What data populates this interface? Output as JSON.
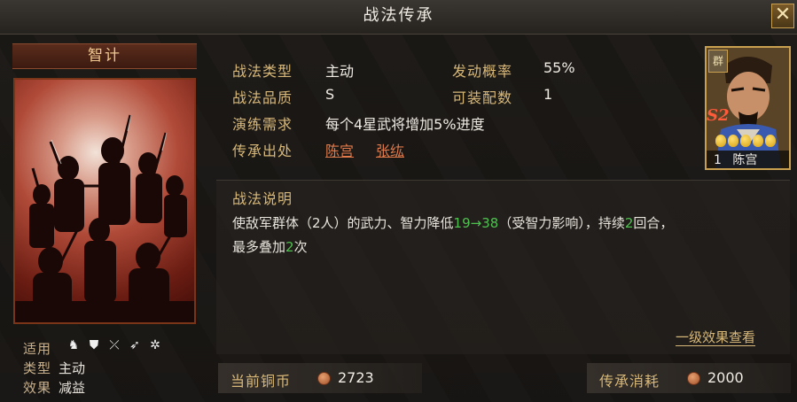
{
  "window": {
    "title": "战法传承",
    "close_label": "✕"
  },
  "skill_card": {
    "name": "智计",
    "terrain_label": "适用",
    "terrain_icons": [
      "cavalry-icon",
      "shield-icon",
      "bow-icon",
      "spear-icon",
      "wheel-icon"
    ],
    "type_label": "类型",
    "type_value": "主动",
    "effect_label": "效果",
    "effect_value": "减益"
  },
  "stats": {
    "type_label": "战法类型",
    "type_value": "主动",
    "quality_label": "战法品质",
    "quality_value": "S",
    "practice_label": "演练需求",
    "practice_value": "每个4星武将增加5%进度",
    "source_label": "传承出处",
    "source_heroes": [
      "陈宫",
      "张纮"
    ],
    "trigger_label": "发动概率",
    "trigger_value": "55%",
    "equip_label": "可装配数",
    "equip_value": "1"
  },
  "hero_portrait": {
    "faction": "群",
    "rank": "S2",
    "level": "1",
    "name": "陈宫",
    "stars": 5
  },
  "description": {
    "title": "战法说明",
    "line1_a": "使敌军群体（2人）的武力、智力降低",
    "line1_from": "19",
    "line1_arrow": "→",
    "line1_to": "38",
    "line1_b": "（受智力影响），持续",
    "line1_turns": "2",
    "line1_c": "回合，",
    "line2_a": "最多叠加",
    "line2_n": "2",
    "line2_b": "次",
    "effect_link": "一级效果查看"
  },
  "currency": {
    "current_label": "当前铜币",
    "current_value": "2723",
    "cost_label": "传承消耗",
    "cost_value": "2000"
  },
  "colors": {
    "accent_gold": "#d8b878",
    "link_red": "#e07a4a",
    "highlight_green": "#4ec24e"
  }
}
